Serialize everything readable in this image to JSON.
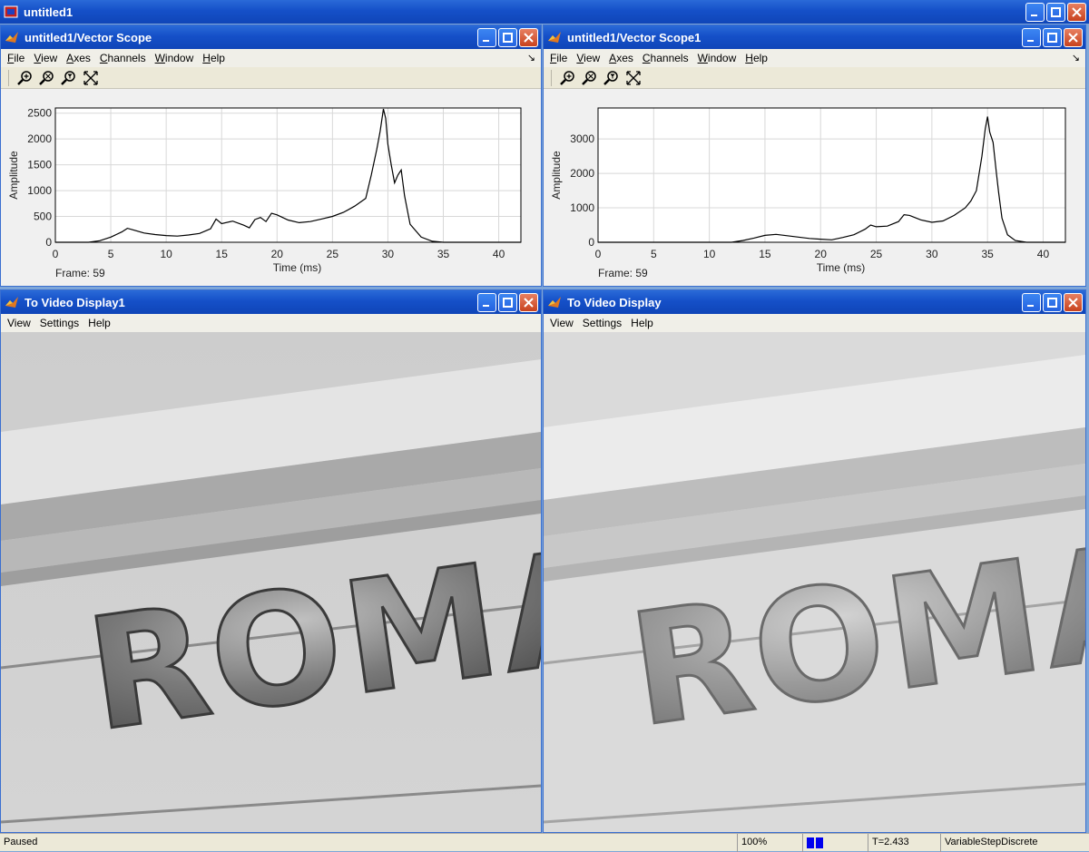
{
  "app": {
    "title": "untitled1"
  },
  "scopes": [
    {
      "title": "untitled1/Vector Scope",
      "menu": [
        "File",
        "View",
        "Axes",
        "Channels",
        "Window",
        "Help"
      ],
      "frame_label": "Frame: 59",
      "chart_data": {
        "type": "line",
        "xlabel": "Time (ms)",
        "ylabel": "Amplitude",
        "xlim": [
          0,
          42
        ],
        "ylim": [
          0,
          2600
        ],
        "xticks": [
          "0",
          "5",
          "10",
          "15",
          "20",
          "25",
          "30",
          "35",
          "40"
        ],
        "yticks": [
          "0",
          "500",
          "1000",
          "1500",
          "2000",
          "2500"
        ],
        "grid": true,
        "series": [
          {
            "x": [
              0,
              3,
              4,
              5,
              6,
              6.5,
              7,
              8,
              9,
              10,
              11,
              12,
              13,
              14,
              14.5,
              15,
              16,
              17,
              17.5,
              18,
              18.5,
              19,
              19.5,
              20,
              21,
              22,
              23,
              24,
              25,
              26,
              27,
              28,
              28.5,
              29,
              29.3,
              29.6,
              29.8,
              30,
              30.3,
              30.6,
              30.9,
              31.2,
              31.5,
              32,
              33,
              34,
              35,
              36,
              40,
              42
            ],
            "y": [
              0,
              0,
              30,
              100,
              200,
              270,
              240,
              180,
              150,
              130,
              120,
              140,
              170,
              260,
              450,
              360,
              410,
              330,
              280,
              440,
              480,
              400,
              560,
              530,
              430,
              380,
              400,
              450,
              500,
              580,
              700,
              850,
              1300,
              1800,
              2150,
              2580,
              2400,
              1900,
              1500,
              1150,
              1300,
              1400,
              900,
              350,
              100,
              20,
              0,
              0,
              0,
              0
            ]
          }
        ]
      }
    },
    {
      "title": "untitled1/Vector Scope1",
      "menu": [
        "File",
        "View",
        "Axes",
        "Channels",
        "Window",
        "Help"
      ],
      "frame_label": "Frame: 59",
      "chart_data": {
        "type": "line",
        "xlabel": "Time (ms)",
        "ylabel": "Amplitude",
        "xlim": [
          0,
          42
        ],
        "ylim": [
          0,
          3900
        ],
        "xticks": [
          "0",
          "5",
          "10",
          "15",
          "20",
          "25",
          "30",
          "35",
          "40"
        ],
        "yticks": [
          "0",
          "1000",
          "2000",
          "3000"
        ],
        "grid": true,
        "series": [
          {
            "x": [
              0,
              12,
              13,
              14,
              15,
              16,
              17,
              18,
              19,
              20,
              21,
              22,
              23,
              24,
              24.5,
              25,
              26,
              27,
              27.5,
              28,
              29,
              30,
              31,
              32,
              33,
              33.5,
              34,
              34.5,
              34.8,
              35,
              35.2,
              35.5,
              35.8,
              36,
              36.3,
              36.8,
              37.5,
              38.5,
              42
            ],
            "y": [
              0,
              0,
              50,
              120,
              200,
              230,
              190,
              150,
              110,
              90,
              70,
              140,
              220,
              380,
              500,
              450,
              470,
              600,
              800,
              780,
              650,
              580,
              620,
              780,
              1000,
              1200,
              1500,
              2500,
              3300,
              3650,
              3200,
              2900,
              2000,
              1450,
              700,
              220,
              50,
              0,
              0
            ]
          }
        ]
      }
    }
  ],
  "videos": [
    {
      "title": "To Video Display1",
      "menu": [
        "View",
        "Settings",
        "Help"
      ],
      "sign_text": "ROMA"
    },
    {
      "title": "To Video Display",
      "menu": [
        "View",
        "Settings",
        "Help"
      ],
      "sign_text": "ROMA"
    }
  ],
  "status": {
    "state": "Paused",
    "zoom": "100%",
    "time": "T=2.433",
    "solver": "VariableStepDiscrete"
  },
  "colors": {
    "title_blue": "#1550c8",
    "accent": "#0000ee"
  }
}
